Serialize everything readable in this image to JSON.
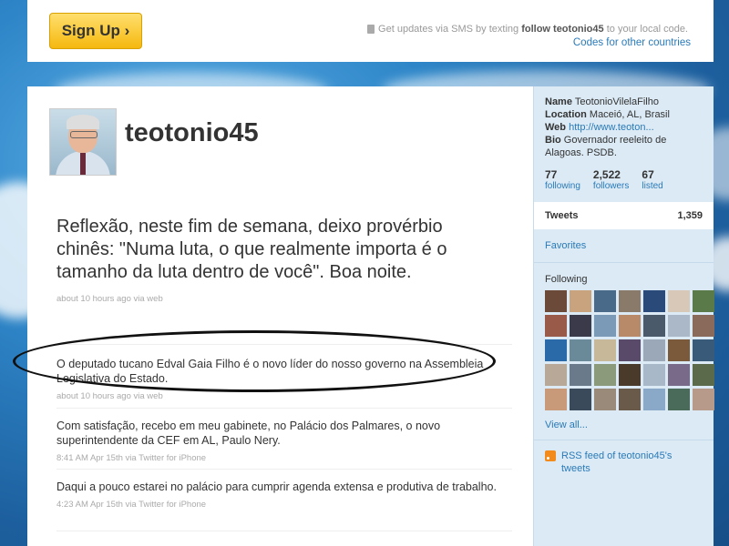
{
  "topbar": {
    "signup_label": "Sign Up ›",
    "sms_prefix": "Get updates via SMS by texting",
    "sms_command": "follow teotonio45",
    "sms_suffix": "to your local code.",
    "codes_link": "Codes for other countries"
  },
  "profile": {
    "screen_name": "teotonio45"
  },
  "tweets": [
    {
      "text": "Reflexão, neste fim de semana, deixo provérbio chinês: \"Numa luta, o que realmente importa é o tamanho da luta dentro de você\". Boa noite.",
      "meta": "about 10 hours ago via web"
    },
    {
      "text": "O deputado tucano Edval Gaia Filho é o novo líder do nosso governo na Assembleia Legislativa do Estado.",
      "meta": "about 10 hours ago via web"
    },
    {
      "text": "Com satisfação, recebo em meu gabinete, no Palácio dos Palmares, o novo superintendente da CEF em AL, Paulo Nery.",
      "meta": "8:41 AM Apr 15th via Twitter for iPhone"
    },
    {
      "text": "Daqui a pouco estarei no palácio para cumprir agenda extensa e produtiva de trabalho.",
      "meta": "4:23 AM Apr 15th via Twitter for iPhone"
    }
  ],
  "sidebar": {
    "name_label": "Name",
    "name_value": "TeotonioVilelaFilho",
    "location_label": "Location",
    "location_value": "Maceió, AL, Brasil",
    "web_label": "Web",
    "web_value": "http://www.teoton...",
    "bio_label": "Bio",
    "bio_value": "Governador reeleito de Alagoas. PSDB.",
    "stats": [
      {
        "n": "77",
        "l": "following"
      },
      {
        "n": "2,522",
        "l": "followers"
      },
      {
        "n": "67",
        "l": "listed"
      }
    ],
    "tweets_label": "Tweets",
    "tweets_count": "1,359",
    "favorites_label": "Favorites",
    "following_label": "Following",
    "view_all": "View all...",
    "rss_label": "RSS feed of teotonio45's tweets"
  },
  "colors": {
    "link": "#2a7ab8",
    "signup": "#f5b80f",
    "sidebar_bg": "#dbeaf5"
  }
}
